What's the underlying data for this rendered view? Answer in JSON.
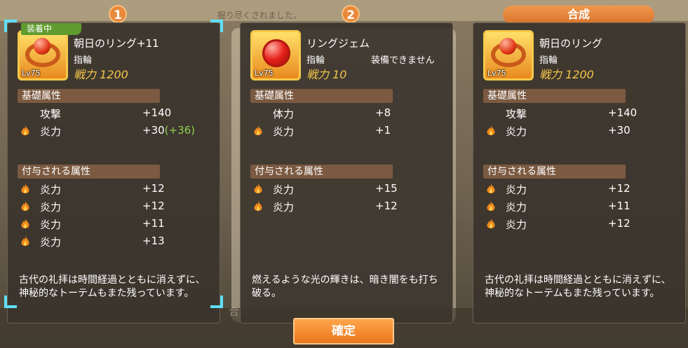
{
  "background": {
    "top_text": "掘り尽くされました。",
    "bottom_text": "合成"
  },
  "tabs": {
    "first_num": "1",
    "second_num": "2",
    "result_label": "合成"
  },
  "panels": [
    {
      "equipped_label": "装着中",
      "level": "Lv75",
      "name": "朝日のリング+11",
      "type": "指輪",
      "note": "",
      "power": "戦力 1200",
      "base_header": "基礎属性",
      "base_rows": [
        {
          "label": "攻撃",
          "value": "+140",
          "bonus": "",
          "icon": ""
        },
        {
          "label": "炎力",
          "value": "+30",
          "bonus": "(+36)",
          "icon": "flame-icon"
        }
      ],
      "extra_header": "付与される属性",
      "extra_rows": [
        {
          "label": "炎力",
          "value": "+12"
        },
        {
          "label": "炎力",
          "value": "+12"
        },
        {
          "label": "炎力",
          "value": "+11"
        },
        {
          "label": "炎力",
          "value": "+13"
        }
      ],
      "description": "古代の礼拝は時間経過とともに消えずに、神秘的なトーテムもまた残っています。"
    },
    {
      "level": "Lv75",
      "name": "リングジェム",
      "type": "指輪",
      "note": "装備できません",
      "power": "戦力 10",
      "base_header": "基礎属性",
      "base_rows": [
        {
          "label": "体力",
          "value": "+8",
          "bonus": "",
          "icon": ""
        },
        {
          "label": "炎力",
          "value": "+1",
          "bonus": "",
          "icon": "flame-icon"
        }
      ],
      "extra_header": "付与される属性",
      "extra_rows": [
        {
          "label": "炎力",
          "value": "+15"
        },
        {
          "label": "炎力",
          "value": "+12"
        }
      ],
      "description": "燃えるような光の輝きは、暗き闇をも打ち破る。"
    },
    {
      "level": "Lv75",
      "name": "朝日のリング",
      "type": "指輪",
      "note": "",
      "power": "戦力 1200",
      "base_header": "基礎属性",
      "base_rows": [
        {
          "label": "攻撃",
          "value": "+140",
          "bonus": "",
          "icon": ""
        },
        {
          "label": "炎力",
          "value": "+30",
          "bonus": "",
          "icon": "flame-icon"
        }
      ],
      "extra_header": "付与される属性",
      "extra_rows": [
        {
          "label": "炎力",
          "value": "+12"
        },
        {
          "label": "炎力",
          "value": "+11"
        },
        {
          "label": "炎力",
          "value": "+12"
        }
      ],
      "description": "古代の礼拝は時間経過とともに消えずに、神秘的なトーテムもまた残っています。"
    }
  ],
  "confirm_label": "確定",
  "colors": {
    "accent": "#e9893a",
    "equipped": "#5f9b2e",
    "power": "#f3c54b",
    "bonus": "#8fd14d",
    "selection": "#5fe0ff"
  }
}
